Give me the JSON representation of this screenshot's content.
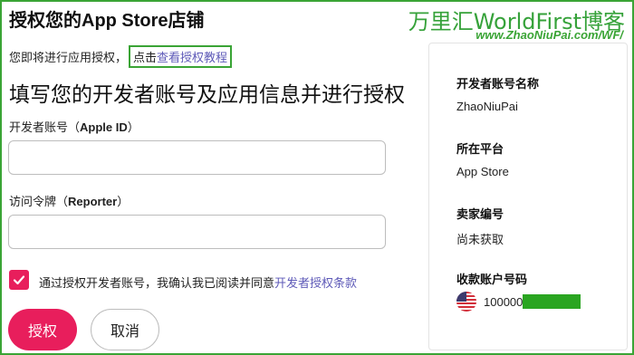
{
  "header": {
    "title": "授权您的App Store店铺"
  },
  "watermark": {
    "main": "万里汇WorldFirst博客",
    "url": "www.ZhaoNiuPai.com/WF/"
  },
  "intro": {
    "text": "您即将进行应用授权，",
    "prefix": "点击",
    "link": "查看授权教程"
  },
  "form": {
    "heading": "填写您的开发者账号及应用信息并进行授权",
    "developer_account": {
      "label": "开发者账号（",
      "label_bold": "Apple ID",
      "label_end": "）",
      "value": "",
      "placeholder": ""
    },
    "access_token": {
      "label": "访问令牌（",
      "label_bold": "Reporter",
      "label_end": "）",
      "value": "",
      "placeholder": ""
    },
    "agreement": {
      "checked": true,
      "text": "通过授权开发者账号，我确认我已阅读并同意",
      "link": "开发者授权条款"
    },
    "buttons": {
      "authorize": "授权",
      "cancel": "取消"
    }
  },
  "side_panel": {
    "developer_name_label": "开发者账号名称",
    "developer_name": "ZhaoNiuPai",
    "platform_label": "所在平台",
    "platform": "App Store",
    "seller_id_label": "卖家编号",
    "seller_id": "尚未获取",
    "payout_account_label": "收款账户号码",
    "payout_account": "100000",
    "payout_flag": "us-flag-icon"
  },
  "colors": {
    "accent": "#e81e5c",
    "link": "#5e5ab8",
    "watermark": "#36a23a"
  }
}
